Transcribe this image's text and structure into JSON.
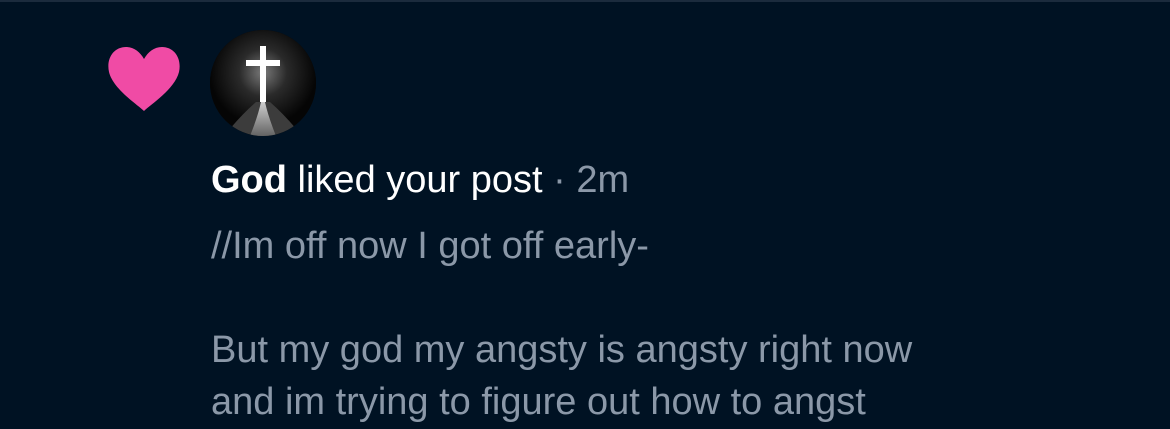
{
  "notification": {
    "icon": "heart-icon",
    "icon_color": "#f04ba5",
    "avatar": "cross-avatar",
    "author": "God",
    "action": "liked your post",
    "separator": "·",
    "time": "2m",
    "post_lines": [
      "//Im off now I got off early-",
      "",
      "But my god my angsty is angsty right now",
      "and im trying to figure out how to angst"
    ]
  },
  "colors": {
    "background": "#001223",
    "primary_text": "#ffffff",
    "secondary_text": "#8b98a8"
  }
}
